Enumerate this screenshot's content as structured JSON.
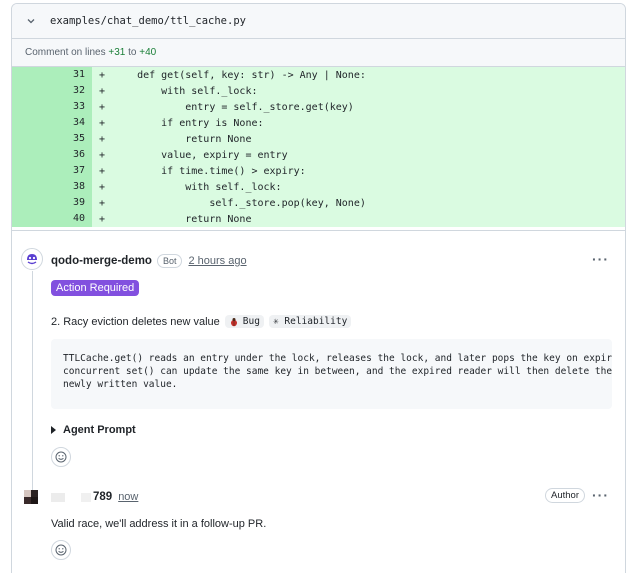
{
  "file": {
    "path": "examples/chat_demo/ttl_cache.py",
    "comment_on_prefix": "Comment on lines",
    "line_start": "+31",
    "to_word": "to",
    "line_end": "+40"
  },
  "code_lines": [
    {
      "num": "31",
      "sign": "+",
      "text": "    def get(self, key: str) -> Any | None:"
    },
    {
      "num": "32",
      "sign": "+",
      "text": "        with self._lock:"
    },
    {
      "num": "33",
      "sign": "+",
      "text": "            entry = self._store.get(key)"
    },
    {
      "num": "34",
      "sign": "+",
      "text": "        if entry is None:"
    },
    {
      "num": "35",
      "sign": "+",
      "text": "            return None"
    },
    {
      "num": "36",
      "sign": "+",
      "text": "        value, expiry = entry"
    },
    {
      "num": "37",
      "sign": "+",
      "text": "        if time.time() > expiry:"
    },
    {
      "num": "38",
      "sign": "+",
      "text": "            with self._lock:"
    },
    {
      "num": "39",
      "sign": "+",
      "text": "                self._store.pop(key, None)"
    },
    {
      "num": "40",
      "sign": "+",
      "text": "            return None"
    }
  ],
  "bot_comment": {
    "author": "qodo-merge-demo",
    "badge": "Bot",
    "time": "2 hours ago",
    "label": "Action Required",
    "issue_title": "2. Racy eviction deletes new value",
    "tag_bug": "Bug",
    "tag_reliability": "✳ Reliability",
    "description_lines": [
      "TTLCache.get() reads an entry under the lock, releases the lock, and later pops the key on expir",
      "concurrent set() can update the same key in between, and the expired reader will then delete the",
      "newly written value."
    ],
    "agent_prompt": "Agent Prompt",
    "menu": "···"
  },
  "reply_comment": {
    "author": "789",
    "time": "now",
    "badge": "Author",
    "body": "Valid race, we'll address it in a follow-up PR.",
    "menu": "···"
  },
  "colors": {
    "added_bg": "#dafbe1",
    "added_num_bg": "#aceebb",
    "label_purple": "#8250df"
  }
}
